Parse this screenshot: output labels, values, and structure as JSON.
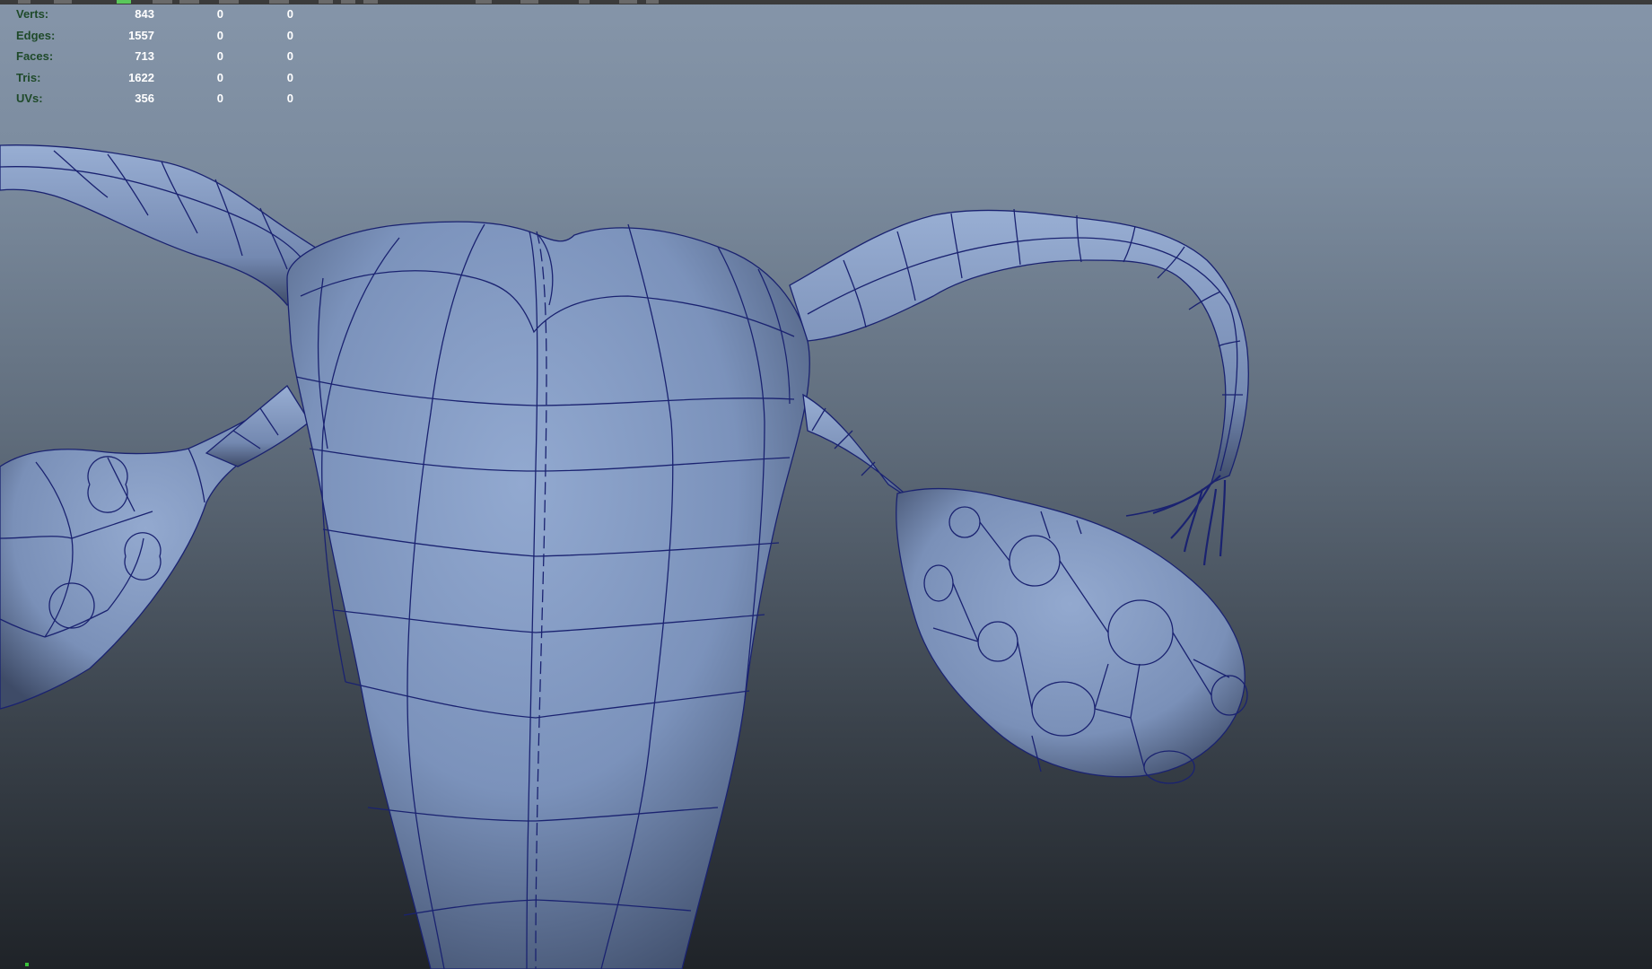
{
  "hud": {
    "rows": [
      {
        "label": "Verts:",
        "values": [
          "843",
          "0",
          "0"
        ]
      },
      {
        "label": "Edges:",
        "values": [
          "1557",
          "0",
          "0"
        ]
      },
      {
        "label": "Faces:",
        "values": [
          "713",
          "0",
          "0"
        ]
      },
      {
        "label": "Tris:",
        "values": [
          "1622",
          "0",
          "0"
        ]
      },
      {
        "label": "UVs:",
        "values": [
          "356",
          "0",
          "0"
        ]
      }
    ]
  },
  "colors": {
    "mesh_fill": "#7f96be",
    "wireframe": "#1a2270",
    "hud_label": "#1f4a2a",
    "hud_value": "#ffffff"
  }
}
